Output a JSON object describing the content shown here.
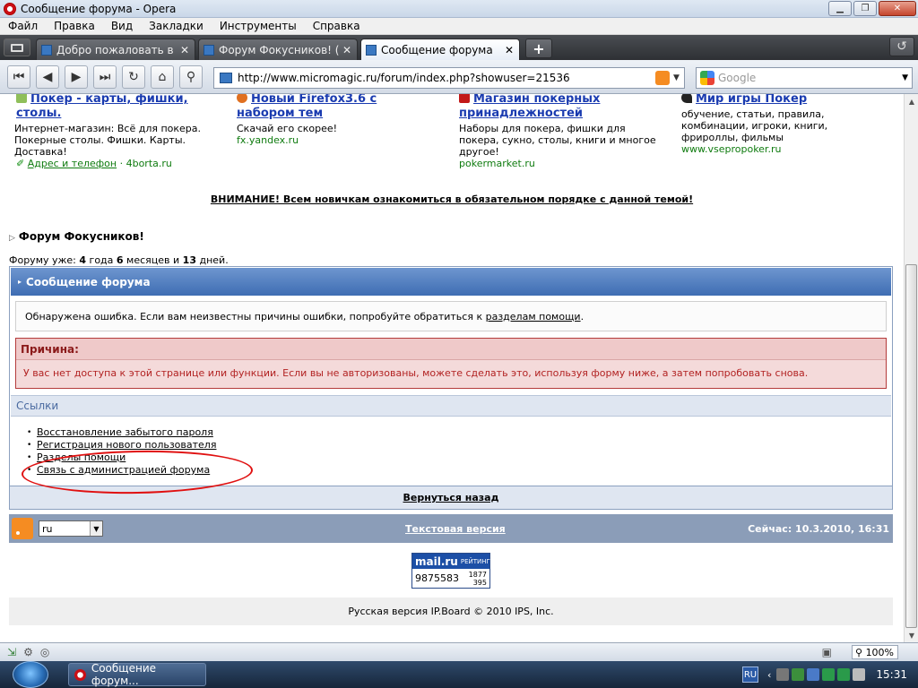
{
  "window": {
    "title": "Сообщение форума - Opera"
  },
  "menu": [
    "Файл",
    "Правка",
    "Вид",
    "Закладки",
    "Инструменты",
    "Справка"
  ],
  "tabs": [
    {
      "label": "Добро пожаловать в ...",
      "active": false
    },
    {
      "label": "Форум Фокусников! (...",
      "active": false
    },
    {
      "label": "Сообщение форума",
      "active": true
    }
  ],
  "address": {
    "url": "http://www.micromagic.ru/forum/index.php?showuser=21536"
  },
  "search": {
    "placeholder": "Google"
  },
  "ads": [
    {
      "title": "Покер - карты, фишки, столы.",
      "desc": "Интернет-магазин: Всё для покера. Покерные столы. Фишки. Карты. Доставка!",
      "extra": "Адрес и телефон",
      "sep": "·",
      "url": "4borta.ru"
    },
    {
      "title": "Новый Firefox3.6 с набором тем",
      "desc": "Скачай его скорее!",
      "url": "fx.yandex.ru"
    },
    {
      "title": "Магазин покерных принадлежностей",
      "desc": "Наборы для покера, фишки для покера, сукно, столы, книги и многое другое!",
      "url": "pokermarket.ru"
    },
    {
      "title": "Мир игры Покер",
      "desc": "обучение, статьи, правила, комбинации, игроки, книги, фрироллы, фильмы",
      "url": "www.vsepropoker.ru"
    }
  ],
  "notice": "ВНИМАНИЕ! Всем новичкам ознакомиться в обязательном порядке с данной темой!",
  "forum": {
    "title": "Форум Фокусников!",
    "age_prefix": "Форуму уже: ",
    "age_years": "4",
    "age_years_word": " года ",
    "age_months": "6",
    "age_months_word": " месяцев и ",
    "age_days": "13",
    "age_days_word": " дней."
  },
  "message": {
    "header": "Сообщение форума",
    "error_text": "Обнаружена ошибка. Если вам неизвестны причины ошибки, попробуйте обратиться к ",
    "error_link": "разделам помощи",
    "error_end": ".",
    "reason_header": "Причина:",
    "reason_text": "У вас нет доступа к этой странице или функции. Если вы не авторизованы, можете сделать это, используя форму ниже, а затем попробовать снова."
  },
  "links": {
    "header": "Ссылки",
    "items": [
      "Восстановление забытого пароля",
      "Регистрация нового пользователя",
      "Разделы помощи",
      "Связь с администрацией форума"
    ]
  },
  "back_label": "Вернуться назад",
  "footer": {
    "language": "ru",
    "text_version": "Текстовая версия",
    "now": "Сейчас: 10.3.2010, 16:31"
  },
  "mail_rating": {
    "brand": "mail.ru",
    "label": "РЕЙТИНГ",
    "visits": "9875583",
    "today": "1877",
    "hosts": "395"
  },
  "copyright": "Русская версия IP.Board © 2010  IPS, Inc.",
  "status": {
    "zoom": "100%"
  },
  "taskbar": {
    "item": "Сообщение форум...",
    "lang": "RU",
    "clock": "15:31"
  }
}
